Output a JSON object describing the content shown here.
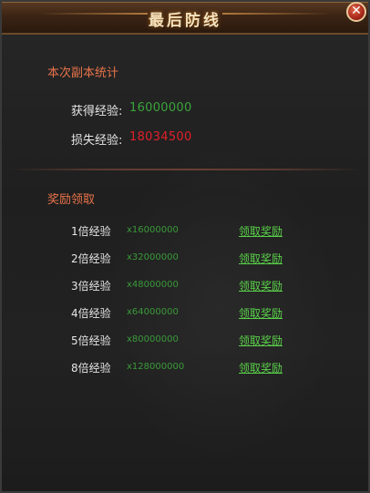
{
  "dialog": {
    "title": "最后防线",
    "close_symbol": "✕"
  },
  "stats": {
    "section_title": "本次副本统计",
    "gain_label": "获得经验:",
    "gain_value": "16000000",
    "loss_label": "损失经验:",
    "loss_value": "18034500",
    "gain_color": "#3aa53a",
    "loss_color": "#e0202a"
  },
  "rewards": {
    "section_title": "奖励领取",
    "claim_label": "领取奖励",
    "items": [
      {
        "label": "1倍经验",
        "amount": "x16000000"
      },
      {
        "label": "2倍经验",
        "amount": "x32000000"
      },
      {
        "label": "3倍经验",
        "amount": "x48000000"
      },
      {
        "label": "4倍经验",
        "amount": "x64000000"
      },
      {
        "label": "5倍经验",
        "amount": "x80000000"
      },
      {
        "label": "8倍经验",
        "amount": "x128000000"
      }
    ]
  },
  "colors": {
    "section_title": "#e8734a",
    "reward_amount": "#3a9a3a",
    "claim_link": "#5ad04a"
  }
}
